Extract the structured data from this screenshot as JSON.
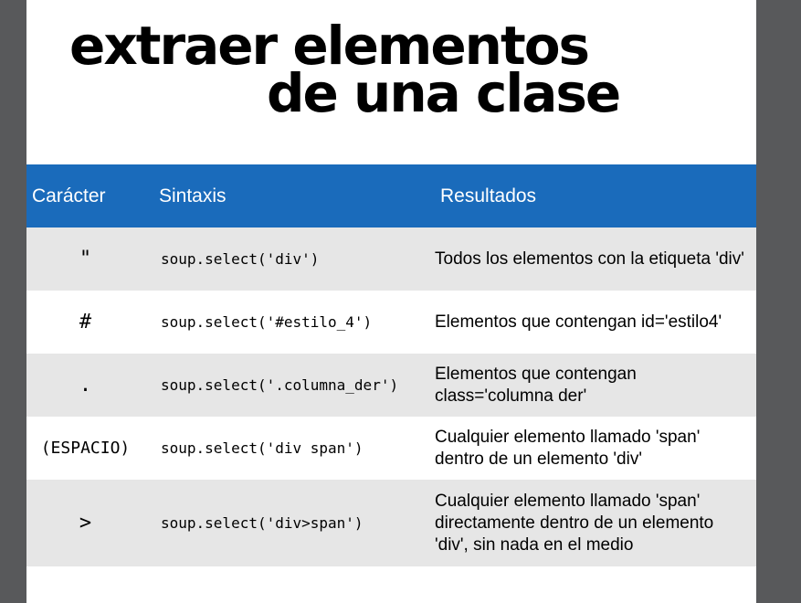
{
  "title": {
    "line1": "extraer elementos",
    "line2": "de una clase"
  },
  "table": {
    "headers": [
      "Carácter",
      "Sintaxis",
      "Resultados"
    ],
    "rows": [
      {
        "char": "\"",
        "syntax": "soup.select('div')",
        "result": "Todos los elementos con la etiqueta 'div'"
      },
      {
        "char": "#",
        "syntax": "soup.select('#estilo_4')",
        "result": "Elementos que contengan id='estilo4'"
      },
      {
        "char": ".",
        "syntax": "soup.select('.columna_der')",
        "result": "Elementos que contengan class='columna der'"
      },
      {
        "char": "(ESPACIO)",
        "syntax": "soup.select('div span')",
        "result": "Cualquier elemento llamado 'span' dentro de un elemento 'div'"
      },
      {
        "char": ">",
        "syntax": "soup.select('div>span')",
        "result": "Cualquier elemento llamado 'span' directamente dentro de un elemento 'div', sin nada en el medio"
      }
    ]
  },
  "colors": {
    "header_bg": "#1a6bbb",
    "row_alt_bg": "#e6e6e6",
    "frame_bg": "#58595b"
  }
}
